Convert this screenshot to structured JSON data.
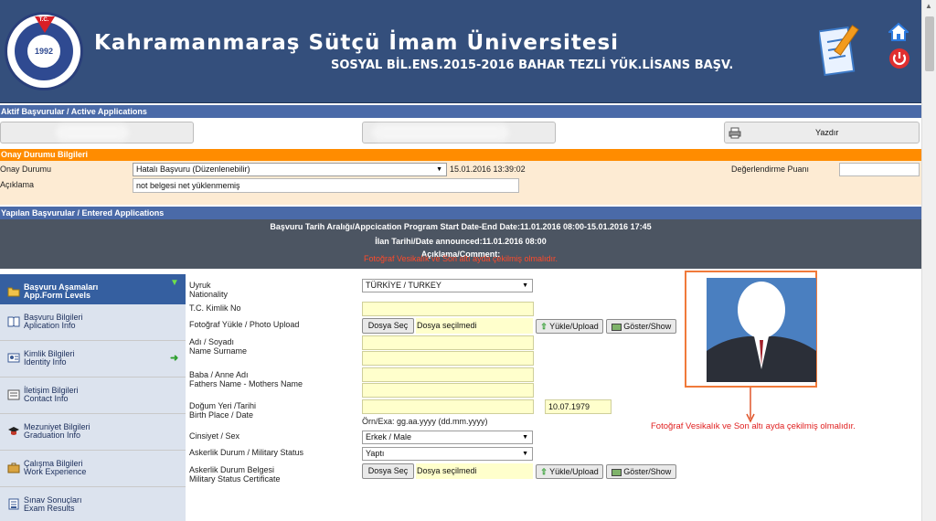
{
  "header": {
    "university": "Kahramanmaraş Sütçü İmam Üniversitesi",
    "program": "SOSYAL BİL.ENS.2015-2016 BAHAR TEZLİ YÜK.LİSANS BAŞV.",
    "logo_year": "1992",
    "logo_tc": "T.C."
  },
  "active": {
    "section_label": "Aktif Başvurular / Active Applications",
    "print_label": "Yazdır"
  },
  "approval": {
    "section_label": "Onay Durumu Bilgileri",
    "status_label": "Onay Durumu",
    "status_value": "Hatalı Başvuru (Düzenlenebilir)",
    "status_date": "15.01.2016 13:39:02",
    "score_label": "Değerlendirme Puanı",
    "comment_label": "Açıklama",
    "comment_value": "not belgesi net yüklenmemiş"
  },
  "entered": {
    "section_label": "Yapılan Başvurular / Entered Applications",
    "date_range": "Başvuru Tarih Aralığı/Appcication Program Start Date-End Date:11.01.2016 08:00-15.01.2016 17:45",
    "announced": "İlan Tarihi/Date announced:11.01.2016 08:00",
    "comment": "Açıklama/Comment:",
    "comment_red": "Fotoğraf Vesikalık ve Son altı ayda çekilmiş olmalıdır."
  },
  "sidebar": {
    "items": [
      {
        "line1": "Başvuru Aşamaları",
        "line2": "App.Form Levels",
        "icon": "folder-icon"
      },
      {
        "line1": "Başvuru Bilgileri",
        "line2": "Aplication Info",
        "icon": "book-icon"
      },
      {
        "line1": "Kimlik Bilgileri",
        "line2": "Identity Info",
        "icon": "id-card-icon"
      },
      {
        "line1": "İletişim Bilgileri",
        "line2": "Contact Info",
        "icon": "contact-card-icon"
      },
      {
        "line1": "Mezuniyet Bilgileri",
        "line2": "Graduation Info",
        "icon": "graduation-cap-icon"
      },
      {
        "line1": "Çalışma Bilgileri",
        "line2": "Work Experience",
        "icon": "briefcase-icon"
      },
      {
        "line1": "Sınav Sonuçları",
        "line2": "Exam Results",
        "icon": "document-icon"
      }
    ]
  },
  "form": {
    "nationality_label1": "Uyruk",
    "nationality_label2": "Nationality",
    "nationality_value": "TÜRKİYE / TURKEY",
    "tc_label": "T.C. Kimlik No",
    "photo_label": "Fotoğraf Yükle / Photo Upload",
    "choose_file": "Dosya Seç",
    "no_file": "Dosya seçilmedi",
    "upload": "Yükle/Upload",
    "show": "Göster/Show",
    "name_label1": "Adı / Soyadı",
    "name_label2": "Name Surname",
    "parents_label1": "Baba / Anne Adı",
    "parents_label2": "Fathers Name - Mothers Name",
    "birth_label1": "Doğum Yeri /Tarihi",
    "birth_label2": "Birth Place / Date",
    "birth_date": "10.07.1979",
    "date_hint": "Örn/Exa: gg.aa.yyyy (dd.mm.yyyy)",
    "gender_label": "Cinsiyet / Sex",
    "gender_value": "Erkek / Male",
    "military_label": "Askerlik Durum / Military Status",
    "military_value": "Yaptı",
    "military_cert_label1": "Askerlik Durum Belgesi",
    "military_cert_label2": "Military Status Certificate",
    "photo_note": "Fotoğraf Vesikalık ve Son altı ayda çekilmiş olmalıdır."
  }
}
